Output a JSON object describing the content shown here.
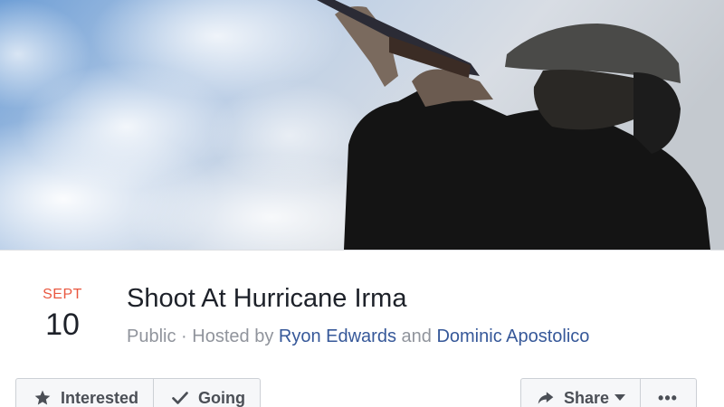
{
  "event": {
    "month": "SEPT",
    "day": "10",
    "title": "Shoot At Hurricane Irma",
    "privacy": "Public",
    "separator": " · ",
    "hosted_by_label": "Hosted by",
    "host_1": "Ryon Edwards",
    "conjunction": "and",
    "host_2": "Dominic Apostolico"
  },
  "actions": {
    "interested_label": "Interested",
    "going_label": "Going",
    "share_label": "Share",
    "more_label": "•••"
  },
  "icons": {
    "interested": "star-icon",
    "going": "check-icon",
    "share": "share-arrow-icon",
    "share_caret": "chevron-down-icon"
  },
  "colors": {
    "date_month": "#e9573f",
    "link": "#365899",
    "meta_gray": "#90949c",
    "title": "#1d2129",
    "button_bg": "#f6f7f9",
    "button_border": "#ccd0d5"
  }
}
